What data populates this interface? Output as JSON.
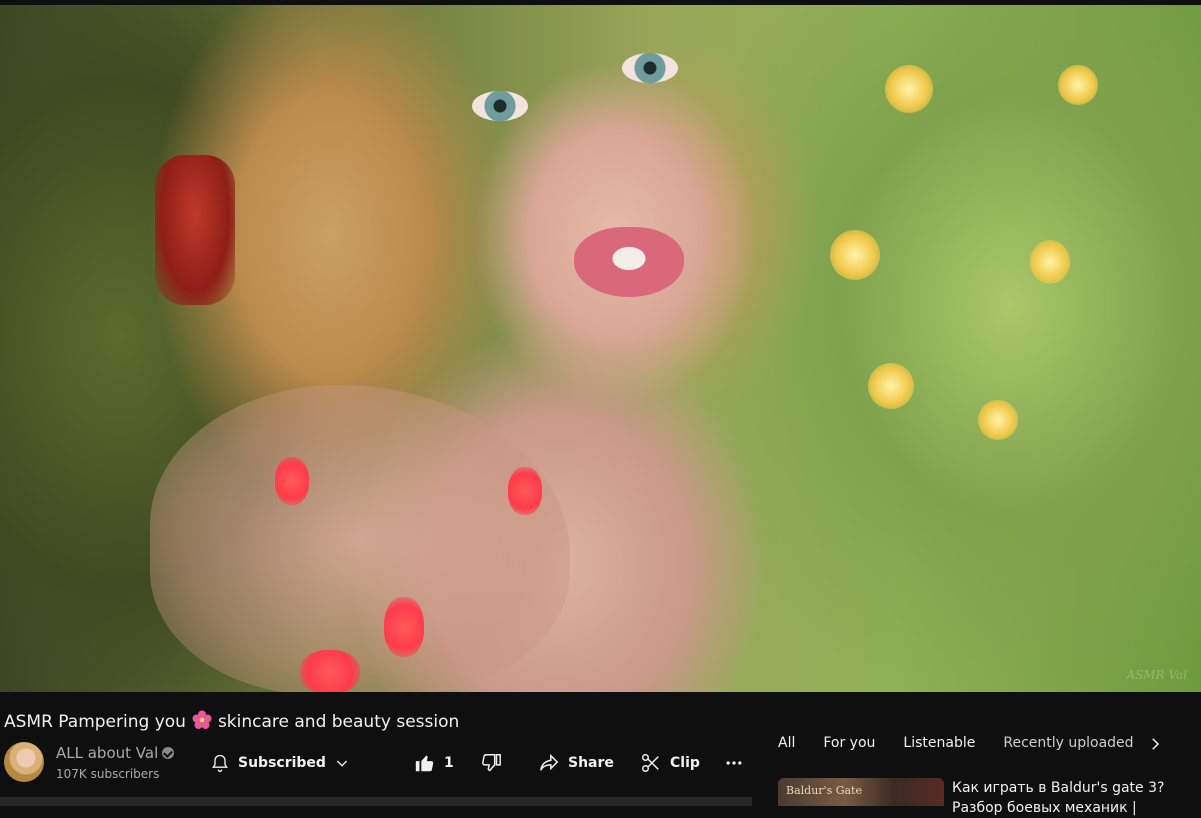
{
  "video": {
    "title": "ASMR Pampering you",
    "title_rest": "skincare and beauty session",
    "title_emoji_icon": "hibiscus-flower-icon",
    "watermark": "ASMR Val"
  },
  "channel": {
    "name": "ALL about Val",
    "subscribers": "107K subscribers",
    "verified": true
  },
  "actions": {
    "subscribed_label": "Subscribed",
    "like_count": "1",
    "share_label": "Share",
    "clip_label": "Clip"
  },
  "chips": [
    "All",
    "For you",
    "Listenable",
    "Recently uploaded"
  ],
  "recommendation": {
    "thumbnail_text": "Baldur's Gate",
    "title": "Как играть в Baldur's gate 3? Разбор боевых механик |"
  },
  "colors": {
    "background": "#0f0f0f",
    "text": "#f1f1f1",
    "secondary_text": "#aaaaaa"
  }
}
